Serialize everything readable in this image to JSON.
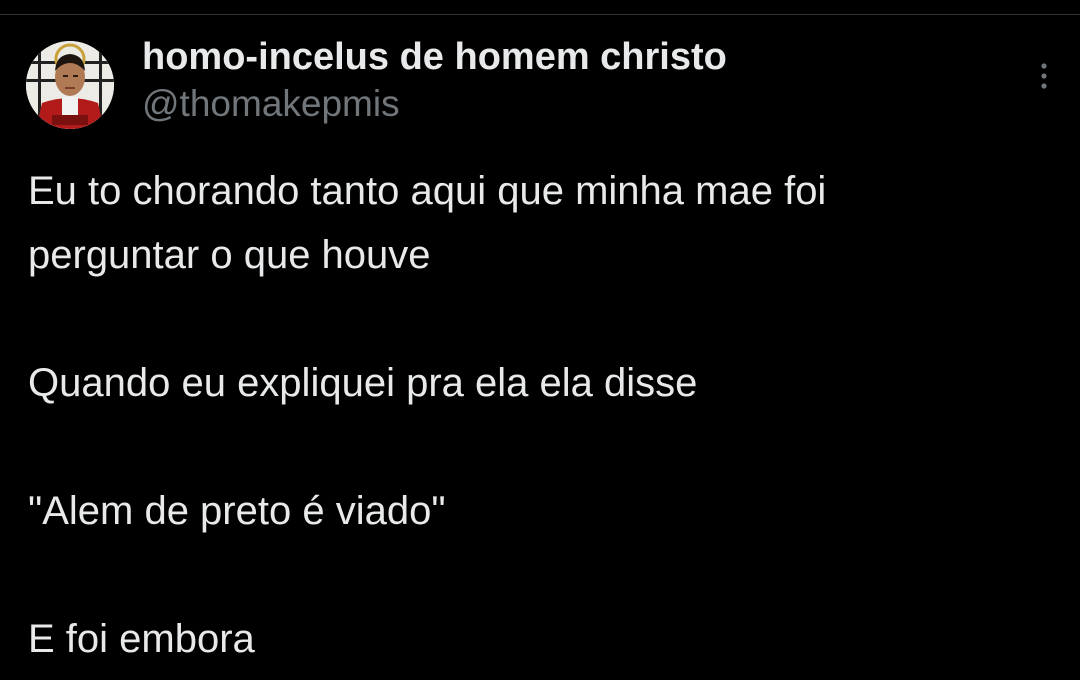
{
  "tweet": {
    "author": {
      "display_name": "homo-incelus de homem christo",
      "handle": "@thomakepmis",
      "avatar_icon": "profile-photo"
    },
    "more_icon": "ellipsis-vertical-icon",
    "paragraphs": [
      [
        "Eu to chorando tanto aqui que minha mae foi",
        "perguntar o que houve"
      ],
      [
        "Quando eu expliquei pra ela ela disse"
      ],
      [
        "\"Alem de preto é viado\""
      ],
      [
        "E foi embora"
      ]
    ]
  },
  "colors": {
    "background": "#000000",
    "primary_text": "#e7e9ea",
    "secondary_text": "#71767b",
    "divider": "#2f3336"
  }
}
